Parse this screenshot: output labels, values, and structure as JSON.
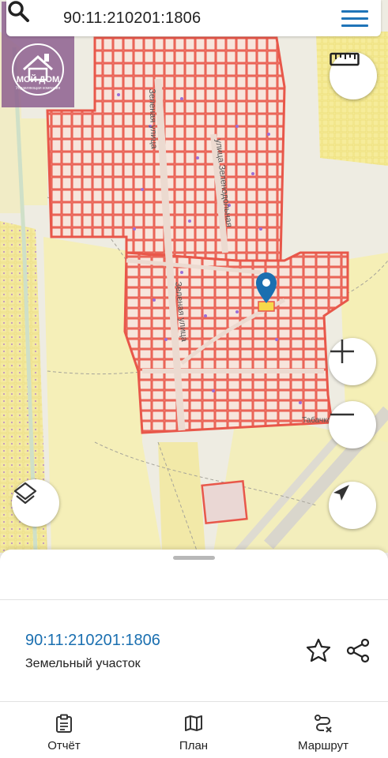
{
  "search": {
    "query": "90:11:210201:1806"
  },
  "logo": {
    "text": "МОЙ ДОМ",
    "subtext": "Управляющая компания"
  },
  "map": {
    "street_labels": [
      "Зеленая улица",
      "улица Зеленодольная",
      "Зеленая улица",
      "Табачко"
    ]
  },
  "colors": {
    "parcel_outline": "#e8574a",
    "accent": "#1f74b8",
    "marker": "#1a6fb0"
  },
  "icons": {
    "search": "search-icon",
    "menu": "menu-icon",
    "ruler": "ruler-icon",
    "zoom_in": "plus-icon",
    "zoom_out": "minus-icon",
    "layers": "layers-icon",
    "locate": "navigation-arrow-icon",
    "favorite": "star-icon",
    "share": "share-icon"
  },
  "sheet": {
    "parcel_id": "90:11:210201:1806",
    "parcel_type": "Земельный участок"
  },
  "tabs": [
    {
      "label": "Отчёт",
      "icon": "clipboard-icon"
    },
    {
      "label": "План",
      "icon": "map-icon"
    },
    {
      "label": "Маршрут",
      "icon": "route-icon"
    }
  ]
}
